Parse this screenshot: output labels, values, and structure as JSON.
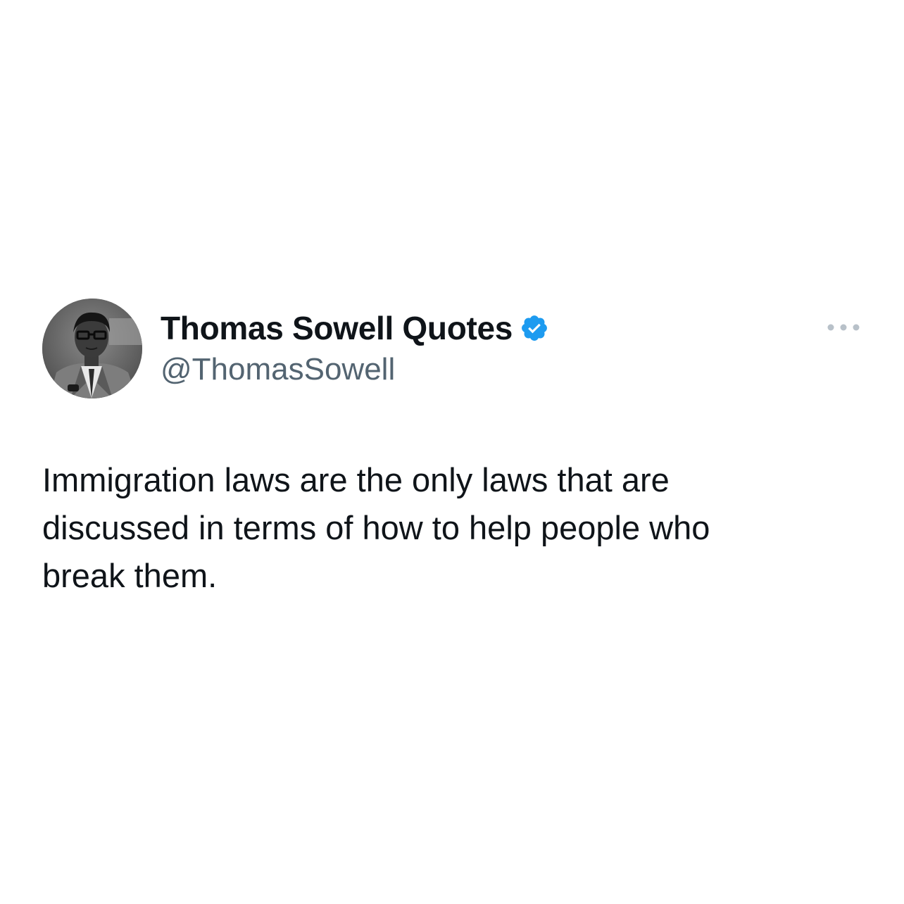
{
  "tweet": {
    "author": {
      "display_name": "Thomas Sowell Quotes",
      "handle": "@ThomasSowell",
      "verified": true,
      "avatar_icon": "profile-photo"
    },
    "text": "Immigration laws are the only laws that are\ndiscussed in terms of how to help people who\nbreak them.",
    "more_icon": "more-options-icon"
  },
  "colors": {
    "background": "#ffffff",
    "text_primary": "#0f1419",
    "text_secondary": "#536471",
    "verified_blue": "#1d9bf0",
    "more_dots": "#b8c1c9"
  }
}
